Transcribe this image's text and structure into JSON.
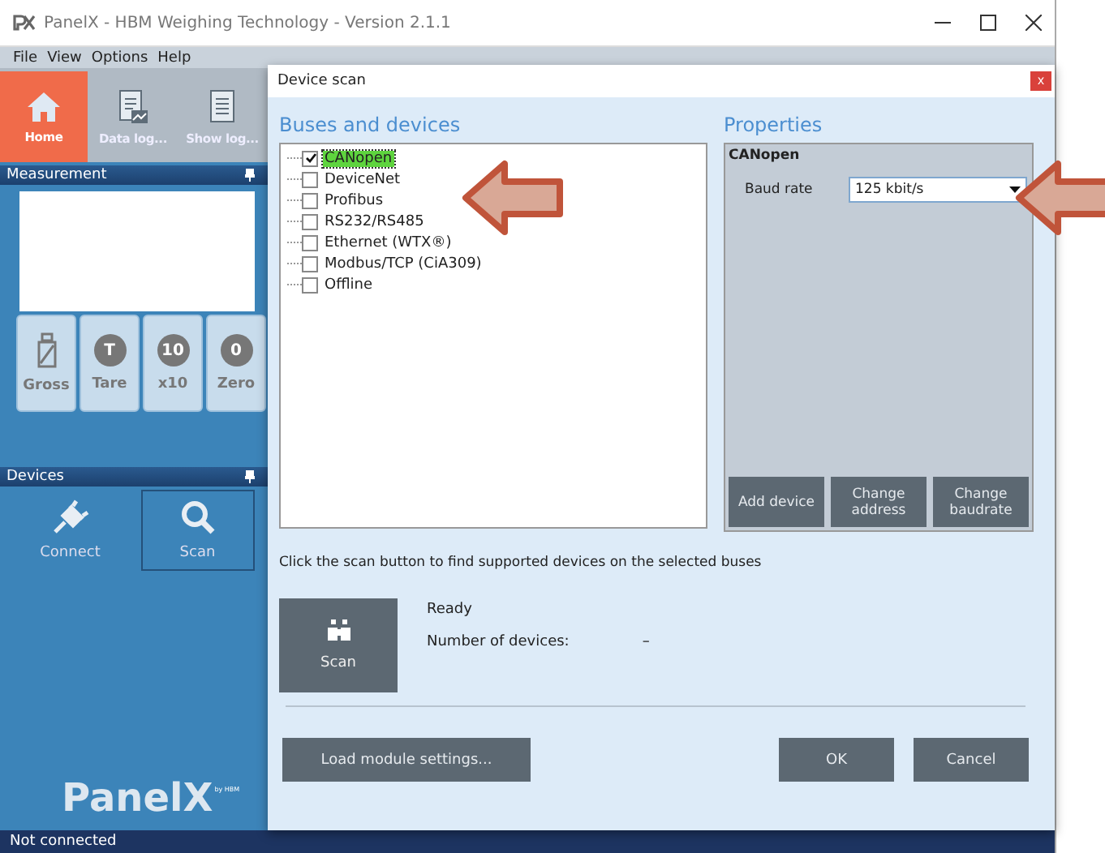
{
  "window": {
    "title": "PanelX - HBM Weighing Technology - Version 2.1.1"
  },
  "menu": [
    "File",
    "View",
    "Options",
    "Help"
  ],
  "toolbar": [
    {
      "label": "Home",
      "kind": "home",
      "selected": true
    },
    {
      "label": "Data log...",
      "kind": "datalog",
      "selected": false
    },
    {
      "label": "Show log...",
      "kind": "showlog",
      "selected": false
    }
  ],
  "measurement_panel": {
    "title": "Measurement",
    "buttons": [
      {
        "label": "Gross",
        "kind": "weight"
      },
      {
        "label": "Tare",
        "kind": "circle",
        "symbol": "T"
      },
      {
        "label": "x10",
        "kind": "circle",
        "symbol": "10"
      },
      {
        "label": "Zero",
        "kind": "circle",
        "symbol": "0"
      }
    ]
  },
  "devices_panel": {
    "title": "Devices",
    "buttons": [
      {
        "label": "Connect",
        "kind": "plug",
        "selected": false
      },
      {
        "label": "Scan",
        "kind": "search",
        "selected": true
      }
    ]
  },
  "logo": {
    "name": "PanelX",
    "tagline": "by HBM"
  },
  "status_bar": "Not connected",
  "dialog": {
    "title": "Device scan",
    "close": "x",
    "buses_heading": "Buses and devices",
    "buses": [
      {
        "label": "CANopen",
        "checked": true,
        "selected": true
      },
      {
        "label": "DeviceNet",
        "checked": false,
        "selected": false
      },
      {
        "label": "Profibus",
        "checked": false,
        "selected": false
      },
      {
        "label": "RS232/RS485",
        "checked": false,
        "selected": false
      },
      {
        "label": "Ethernet (WTX®)",
        "checked": false,
        "selected": false
      },
      {
        "label": "Modbus/TCP (CiA309)",
        "checked": false,
        "selected": false
      },
      {
        "label": "Offline",
        "checked": false,
        "selected": false
      }
    ],
    "properties": {
      "heading": "Properties",
      "title": "CANopen",
      "fields": [
        {
          "label": "Baud rate",
          "value": "125 kbit/s"
        }
      ],
      "buttons": [
        "Add device",
        "Change address",
        "Change baudrate"
      ]
    },
    "hint": "Click the scan button to find supported devices on the selected buses",
    "scan_button": "Scan",
    "status": "Ready",
    "count_label": "Number of devices:",
    "count_value": "–",
    "buttons": [
      "Load module settings...",
      "OK",
      "Cancel"
    ]
  }
}
